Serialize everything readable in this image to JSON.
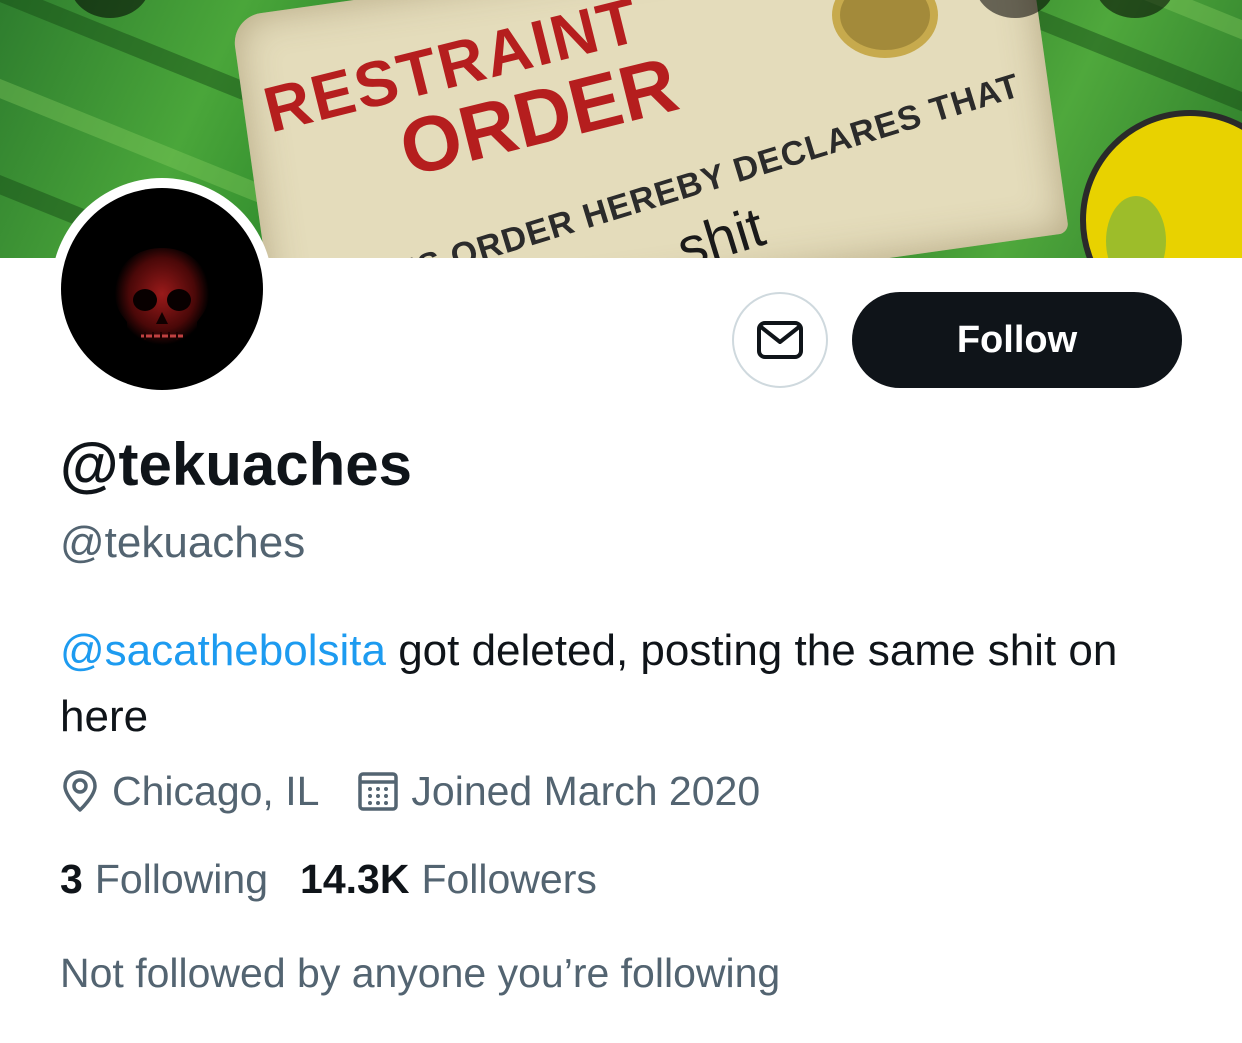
{
  "banner": {
    "text_restraint": "RESTRAINT",
    "text_order": "ORDER",
    "text_declares": "THIS ORDER HEREBY DECLARES THAT",
    "text_shit": "shit"
  },
  "avatar": {
    "icon": "skull-icon",
    "background": "#000000",
    "tint": "#7a1010"
  },
  "actions": {
    "message_icon": "envelope-icon",
    "follow_label": "Follow"
  },
  "profile": {
    "display_name": "@tekuaches",
    "handle": "@tekuaches",
    "bio_mention": "@sacathebolsita",
    "bio_text": " got deleted, posting the same shit on here",
    "location_icon": "location-pin-icon",
    "location": "Chicago, IL",
    "joined_icon": "calendar-icon",
    "joined": "Joined March 2020",
    "following_count": "3",
    "following_label": "Following",
    "followers_count": "14.3K",
    "followers_label": "Followers",
    "not_followed_text": "Not followed by anyone you’re following"
  },
  "colors": {
    "text_primary": "#0f1419",
    "text_secondary": "#536471",
    "link": "#1d9bf0",
    "follow_button_bg": "#0f1419"
  }
}
